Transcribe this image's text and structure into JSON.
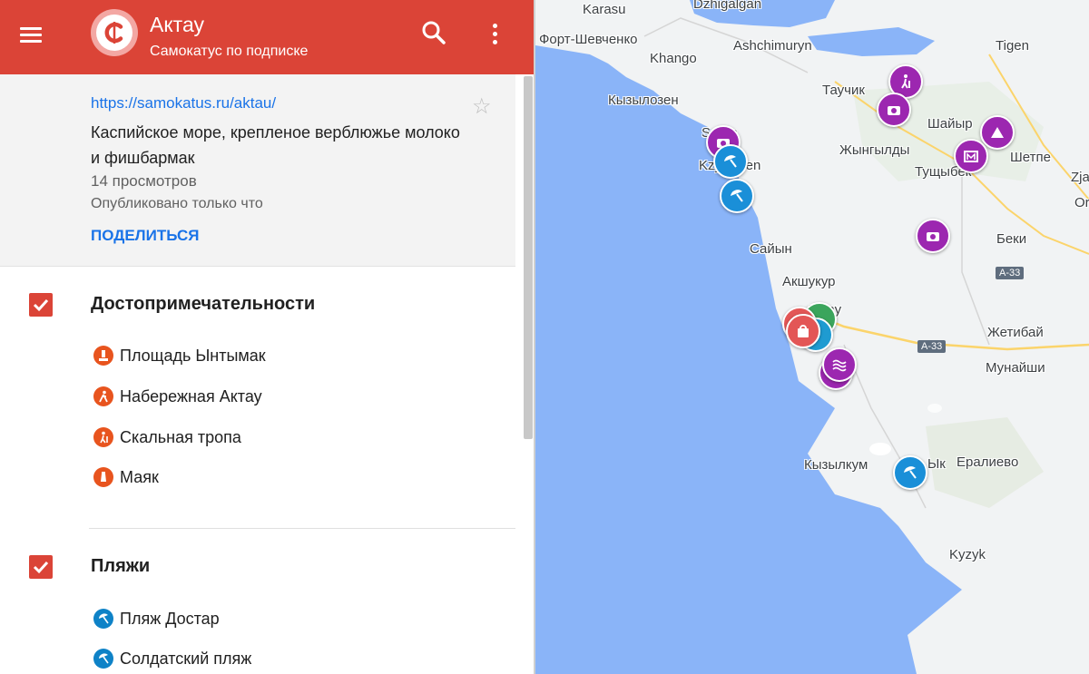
{
  "app": {
    "title": "Актау",
    "subtitle": "Самокатус по подписке",
    "accent_color": "#db4437"
  },
  "toolbar": {
    "menu_icon": "hamburger-menu-icon",
    "search_icon": "search-icon",
    "more_icon": "more-vert-icon"
  },
  "info": {
    "url": "https://samokatus.ru/aktau/",
    "description": "Каспийское море, крепленое верблюжье молоко и фишбармак",
    "views": "14 просмотров",
    "published": "Опубликовано только что",
    "share_label": "ПОДЕЛИТЬСЯ",
    "star_symbol": "☆"
  },
  "sections": [
    {
      "title": "Достопримечательности",
      "checked": true,
      "items": [
        {
          "label": "Площадь Ынтымак",
          "icon": "monument-icon"
        },
        {
          "label": "Набережная Актау",
          "icon": "walker-icon"
        },
        {
          "label": "Скальная тропа",
          "icon": "hiker-icon"
        },
        {
          "label": "Маяк",
          "icon": "lighthouse-icon"
        }
      ]
    },
    {
      "title": "Пляжи",
      "checked": true,
      "items": [
        {
          "label": "Пляж Достар",
          "icon": "beach-umbrella-icon"
        },
        {
          "label": "Солдатский пляж",
          "icon": "beach-umbrella-icon"
        }
      ]
    }
  ],
  "map": {
    "places": [
      "Karasu",
      "Dzhigalgan",
      "Форт-Шевченко",
      "Ashchimuryn",
      "Tigen",
      "Khango",
      "Таучик",
      "Кызылозен",
      "Шайыр",
      "Жынгылды",
      "Тущыбек",
      "Шетпе",
      "Zja",
      "Or",
      "Saura",
      "Kzyl-Uzen",
      "Сайын",
      "Беки",
      "Акшукур",
      "Актау",
      "Жетибай",
      "Мунайши",
      "Кызылкум",
      "Ык",
      "Ералиево",
      "Kyzyk"
    ],
    "roads": [
      "A-33",
      "A-33"
    ]
  }
}
